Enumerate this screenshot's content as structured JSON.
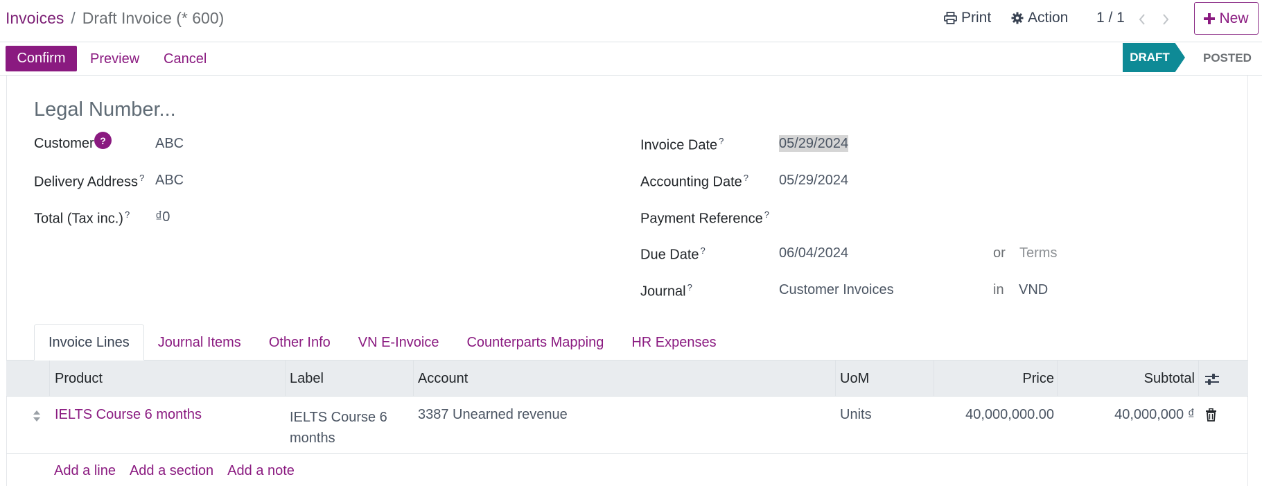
{
  "breadcrumb": {
    "parent": "Invoices",
    "separator": "/",
    "current": "Draft Invoice (* 600)"
  },
  "toolbar": {
    "print_label": "Print",
    "action_label": "Action",
    "pager": "1 / 1",
    "new_label": "New"
  },
  "statusbar": {
    "confirm_label": "Confirm",
    "preview_label": "Preview",
    "cancel_label": "Cancel",
    "stages": [
      "DRAFT",
      "POSTED"
    ],
    "active_stage": "DRAFT"
  },
  "form": {
    "legal_number_placeholder": "Legal Number...",
    "help_badge": "?",
    "left": [
      {
        "label": "Customer",
        "value": "ABC"
      },
      {
        "label": "Delivery Address",
        "sup": "?",
        "value": "ABC"
      },
      {
        "label": "Total (Tax inc.)",
        "sup": "?",
        "value": "₫0"
      }
    ],
    "right": [
      {
        "label": "Invoice Date",
        "sup": "?",
        "value": "05/29/2024"
      },
      {
        "label": "Accounting Date",
        "sup": "?",
        "value": "05/29/2024"
      },
      {
        "label": "Payment Reference",
        "sup": "?",
        "value": ""
      },
      {
        "label": "Due Date",
        "sup": "?",
        "value": "06/04/2024",
        "connector": "or",
        "extra": "Terms"
      },
      {
        "label": "Journal",
        "sup": "?",
        "value": "Customer Invoices",
        "connector": "in",
        "extra": "VND"
      }
    ]
  },
  "tabs": [
    "Invoice Lines",
    "Journal Items",
    "Other Info",
    "VN E-Invoice",
    "Counterparts Mapping",
    "HR Expenses"
  ],
  "active_tab": "Invoice Lines",
  "table": {
    "columns": [
      "Product",
      "Label",
      "Account",
      "UoM",
      "Price",
      "Subtotal"
    ],
    "rows": [
      {
        "product": "IELTS Course 6 months",
        "label_line1": "IELTS Course 6",
        "label_line2": "months",
        "account": "3387 Unearned revenue",
        "uom": "Units",
        "price": "40,000,000.00",
        "subtotal": "40,000,000 ₫"
      }
    ],
    "add_line": "Add a line",
    "add_section": "Add a section",
    "add_note": "Add a note"
  },
  "colors": {
    "brand": "#8a1a80",
    "stage_active": "#0e8a96"
  }
}
